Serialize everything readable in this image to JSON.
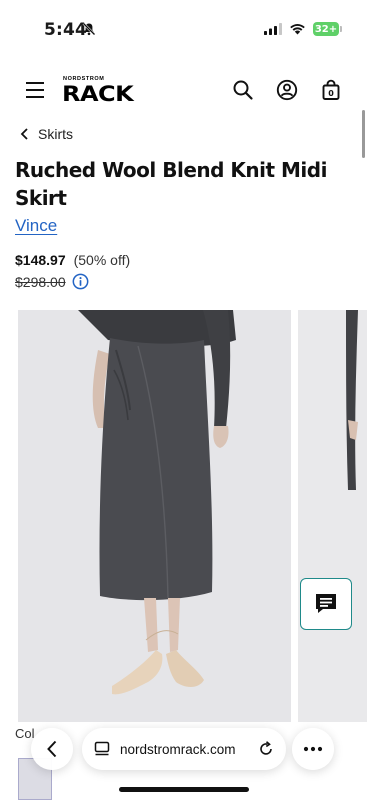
{
  "status_bar": {
    "time": "5:44",
    "battery": "32+"
  },
  "header": {
    "logo_top": "NORDSTROM",
    "logo_main": "RACK"
  },
  "breadcrumb": {
    "label": "Skirts"
  },
  "product": {
    "title": "Ruched Wool Blend Knit Midi Skirt",
    "brand": "Vince",
    "price_now": "$148.97",
    "discount": "(50% off)",
    "price_was": "$298.00"
  },
  "color": {
    "label": "Col"
  },
  "safari": {
    "url": "nordstromrack.com"
  },
  "colors": {
    "accent": "#2364c4",
    "chat_border": "#1f8a8a",
    "battery": "#5fd068"
  }
}
